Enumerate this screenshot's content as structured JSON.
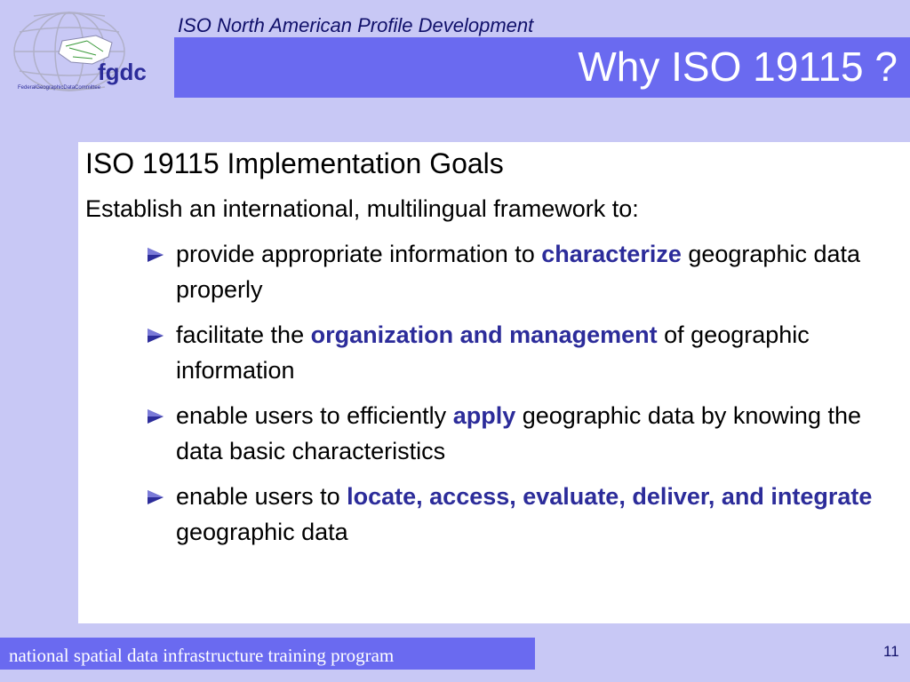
{
  "header": {
    "subtitle": "ISO North American Profile Development",
    "title": "Why ISO 19115 ?"
  },
  "logo": {
    "name": "fgdc",
    "tagline": "FederalGeographicDataCommittee",
    "icon": "globe-map-icon"
  },
  "content": {
    "heading": "ISO 19115 Implementation Goals",
    "intro": "Establish an international, multilingual framework to:",
    "bullet_icon": "triangle-arrow-icon",
    "bullets": [
      {
        "before": "provide appropriate information to ",
        "highlight": "characterize",
        "after": " geographic data properly"
      },
      {
        "before": "facilitate the ",
        "highlight": "organization and management",
        "after": " of geographic information"
      },
      {
        "before": "enable users to efficiently ",
        "highlight": "apply",
        "after": " geographic data by knowing the data basic characteristics"
      },
      {
        "before": "enable users to ",
        "highlight": "locate, access, evaluate, deliver, and integrate",
        "after": " geographic data"
      }
    ]
  },
  "footer": {
    "text": "national spatial data infrastructure training program",
    "page_number": "11"
  },
  "colors": {
    "background": "#c8c8f5",
    "band": "#6a6af0",
    "highlight": "#2c2c9a",
    "panel": "#ffffff"
  }
}
